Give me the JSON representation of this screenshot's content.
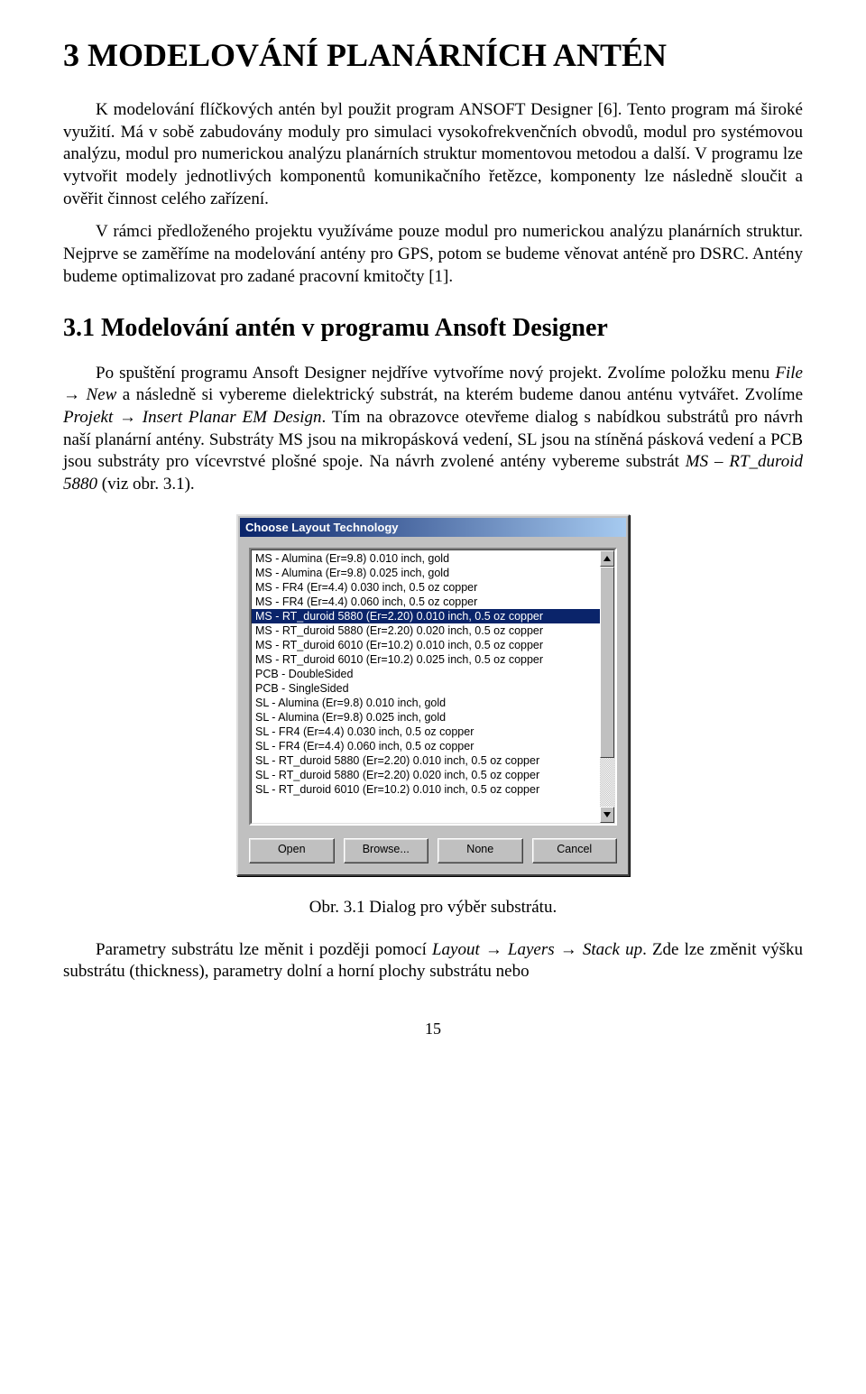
{
  "heading1": "3   MODELOVÁNÍ PLANÁRNÍCH ANTÉN",
  "para1": "K modelování flíčkových antén byl použit program ANSOFT Designer [6]. Tento program má široké využití. Má v sobě zabudovány moduly pro simulaci vysokofrekvenčních obvodů, modul pro systémovou analýzu, modul pro numerickou analýzu planárních struktur momentovou metodou a další. V programu lze vytvořit modely jednotlivých komponentů komunikačního řetězce, komponenty lze následně sloučit a ověřit činnost celého zařízení.",
  "para2": "V rámci předloženého projektu využíváme pouze modul pro numerickou analýzu planárních struktur. Nejprve se zaměříme na modelování antény pro GPS, potom se budeme věnovat anténě pro DSRC. Antény budeme optimalizovat pro zadané pracovní kmitočty [1].",
  "heading2": "3.1   Modelování antén v programu Ansoft Designer",
  "para3a": "Po spuštění programu Ansoft Designer nejdříve vytvoříme nový projekt. Zvolíme položku menu ",
  "para3b": "File → New",
  "para3c": " a následně si vybereme dielektrický substrát, na kterém budeme danou anténu vytvářet. Zvolíme ",
  "para3d": "Projekt → Insert Planar EM Design",
  "para3e": ". Tím na obrazovce otevřeme dialog s nabídkou substrátů pro návrh naší planární antény. Substráty MS jsou na mikropásková vedení, SL jsou na stíněná pásková vedení a PCB jsou substráty pro vícevrstvé plošné spoje. Na návrh zvolené antény vybereme substrát ",
  "para3f": "MS – RT_duroid 5880",
  "para3g": " (viz obr. 3.1).",
  "dialog": {
    "title": "Choose Layout Technology",
    "items": [
      "MS - Alumina (Er=9.8) 0.010 inch, gold",
      "MS - Alumina (Er=9.8) 0.025 inch, gold",
      "MS - FR4 (Er=4.4) 0.030 inch, 0.5 oz copper",
      "MS - FR4 (Er=4.4) 0.060 inch, 0.5 oz copper",
      "MS - RT_duroid 5880 (Er=2.20) 0.010 inch, 0.5 oz copper",
      "MS - RT_duroid 5880 (Er=2.20) 0.020 inch, 0.5 oz copper",
      "MS - RT_duroid 6010 (Er=10.2) 0.010 inch, 0.5 oz copper",
      "MS - RT_duroid 6010 (Er=10.2) 0.025 inch, 0.5 oz copper",
      "PCB - DoubleSided",
      "PCB - SingleSided",
      "SL - Alumina (Er=9.8) 0.010 inch, gold",
      "SL - Alumina (Er=9.8) 0.025 inch, gold",
      "SL - FR4 (Er=4.4) 0.030 inch, 0.5 oz copper",
      "SL - FR4 (Er=4.4) 0.060 inch, 0.5 oz copper",
      "SL - RT_duroid 5880 (Er=2.20) 0.010 inch, 0.5 oz copper",
      "SL - RT_duroid 5880 (Er=2.20) 0.020 inch, 0.5 oz copper",
      "SL - RT_duroid 6010 (Er=10.2) 0.010 inch, 0.5 oz copper"
    ],
    "selected_index": 4,
    "buttons": {
      "open": "Open",
      "browse": "Browse...",
      "none": "None",
      "cancel": "Cancel"
    }
  },
  "caption": "Obr. 3.1 Dialog pro výběr substrátu.",
  "para4a": "Parametry substrátu lze měnit i později pomocí ",
  "para4b": "Layout → Layers → Stack up",
  "para4c": ". Zde lze změnit výšku substrátu (thickness), parametry dolní a horní plochy substrátu nebo",
  "pagenum": "15"
}
